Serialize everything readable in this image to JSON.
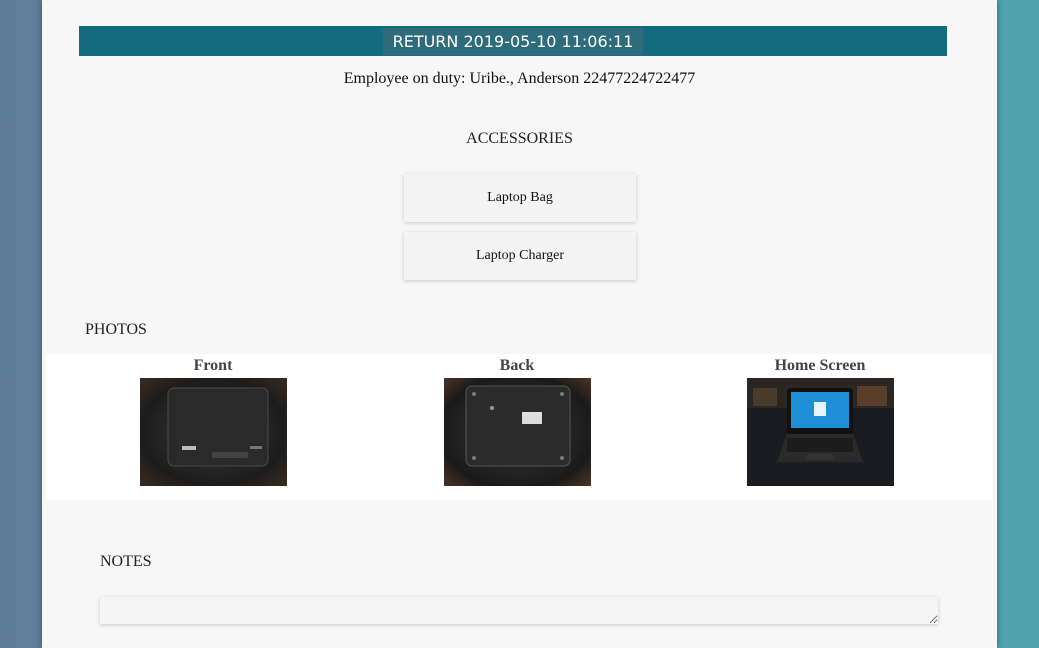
{
  "header": {
    "return_label": "RETURN 2019-05-10 11:06:11"
  },
  "employee": {
    "text": "Employee on duty: Uribe., Anderson 22477224722477"
  },
  "accessories": {
    "title": "ACCESSORIES",
    "items": [
      {
        "label": "Laptop Bag"
      },
      {
        "label": "Laptop Charger"
      }
    ]
  },
  "photos": {
    "title": "PHOTOS",
    "items": [
      {
        "label": "Front"
      },
      {
        "label": "Back"
      },
      {
        "label": "Home Screen"
      }
    ]
  },
  "notes": {
    "title": "NOTES",
    "value": ""
  },
  "colors": {
    "header_bar": "#136c7d",
    "panel": "#f7f7f7"
  }
}
